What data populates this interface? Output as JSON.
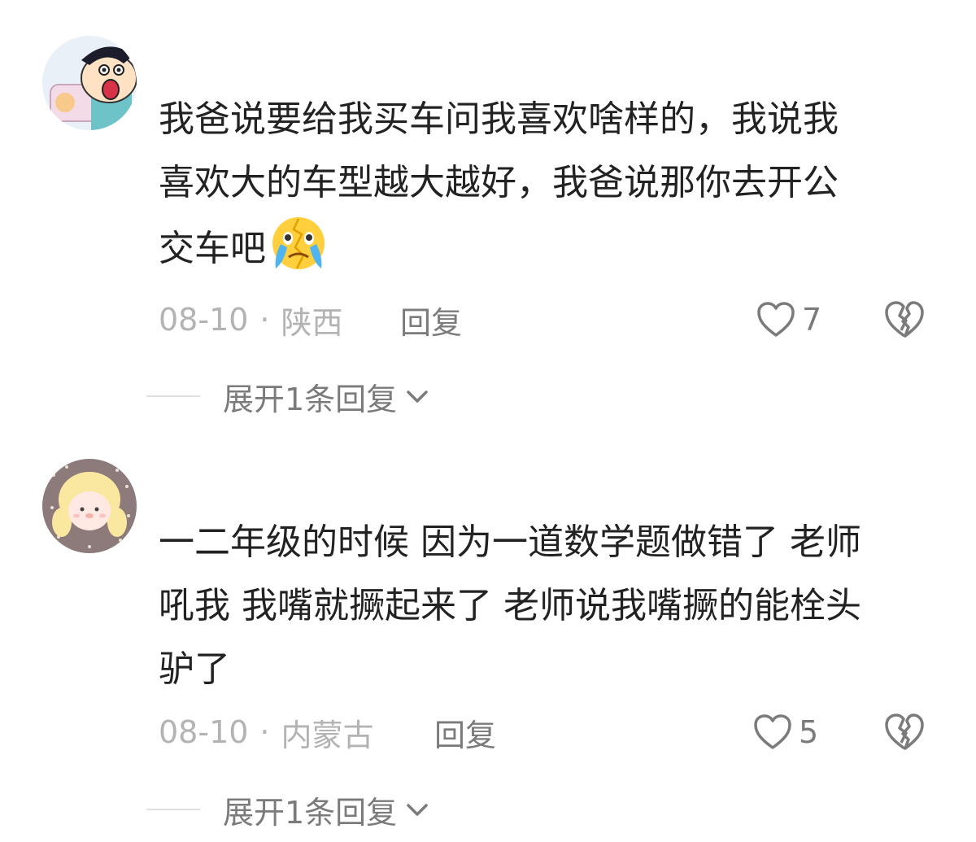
{
  "comments": [
    {
      "avatar": "cartoon-boy-avatar",
      "lines": [
        "我爸说要给我买车问我喜欢啥样的，我说我",
        "喜欢大的车型越大越好，我爸说那你去开公",
        "交车吧"
      ],
      "emoji": "crying-emoji",
      "date": "08-10",
      "separator": "·",
      "location": "陕西",
      "reply_label": "回复",
      "likes": "7",
      "expand_label": "展开1条回复"
    },
    {
      "avatar": "blonde-girl-avatar",
      "lines": [
        "一二年级的时候 因为一道数学题做错了 老师",
        "吼我 我嘴就撅起来了 老师说我嘴撅的能栓头",
        "驴了"
      ],
      "date": "08-10",
      "separator": "·",
      "location": "内蒙古",
      "reply_label": "回复",
      "likes": "5",
      "expand_label": "展开1条回复"
    }
  ],
  "colors": {
    "text": "#222222",
    "meta": "#b3b3b3",
    "action": "#7b7b7b"
  }
}
